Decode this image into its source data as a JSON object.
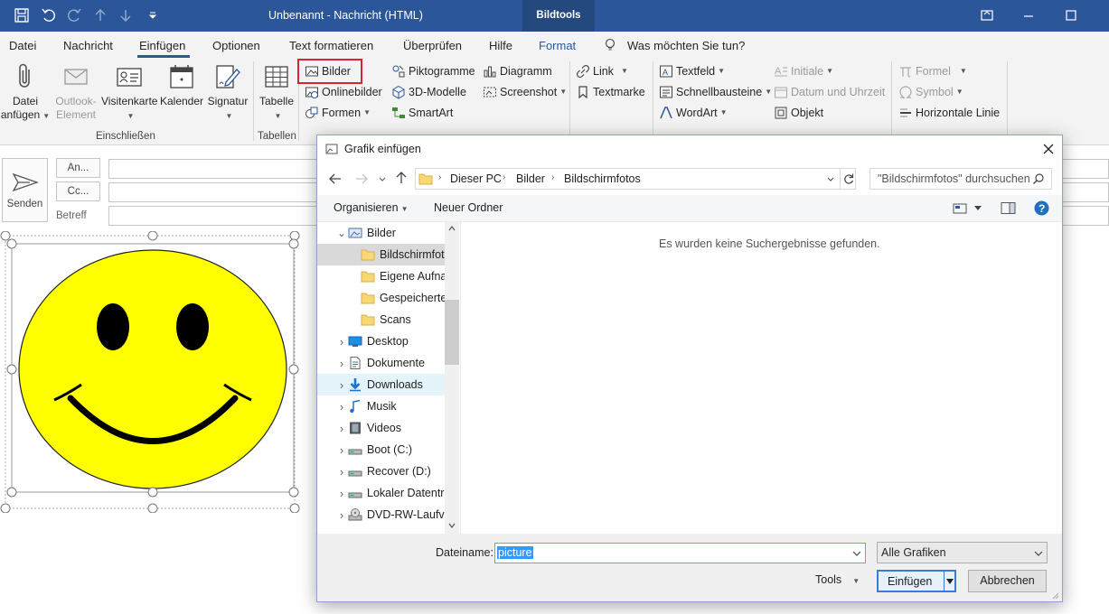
{
  "window": {
    "title": "Unbenannt  -  Nachricht (HTML)",
    "context_tab": "Bildtools"
  },
  "tabs": [
    "Datei",
    "Nachricht",
    "Einfügen",
    "Optionen",
    "Text formatieren",
    "Überprüfen",
    "Hilfe",
    "Format"
  ],
  "active_tab": "Einfügen",
  "tell_me": "Was möchten Sie tun?",
  "ribbon": {
    "include": {
      "attach_file": [
        "Datei",
        "anfügen"
      ],
      "outlook_item": [
        "Outlook-",
        "Element"
      ],
      "business_card": "Visitenkarte",
      "calendar": "Kalender",
      "signature": "Signatur",
      "group_label": "Einschließen"
    },
    "tables": {
      "table": "Tabelle",
      "group_label": "Tabellen"
    },
    "illustrations": {
      "pictures": "Bilder",
      "online_pictures": "Onlinebilder",
      "shapes": "Formen",
      "icons": "Piktogramme",
      "models_3d": "3D-Modelle",
      "smartart": "SmartArt",
      "chart": "Diagramm",
      "screenshot": "Screenshot"
    },
    "links": {
      "link": "Link",
      "bookmark": "Textmarke"
    },
    "text": {
      "textbox": "Textfeld",
      "quick_parts": "Schnellbausteine",
      "wordart": "WordArt",
      "dropcap": "Initiale",
      "date_time": "Datum und Uhrzeit",
      "object": "Objekt"
    },
    "symbols": {
      "equation": "Formel",
      "symbol": "Symbol",
      "horizontal_line": "Horizontale Linie"
    }
  },
  "message": {
    "send": "Senden",
    "to": "An...",
    "cc": "Cc...",
    "subject": "Betreff"
  },
  "dialog": {
    "title": "Grafik einfügen",
    "breadcrumb": [
      "Dieser PC",
      "Bilder",
      "Bildschirmfotos"
    ],
    "search_placeholder": "\"Bildschirmfotos\" durchsuchen",
    "organize": "Organisieren",
    "new_folder": "Neuer Ordner",
    "tree": [
      {
        "label": "Bilder",
        "expanded": true,
        "icon": "pictures-library-icon"
      },
      {
        "label": "Bildschirmfot",
        "child": true,
        "selected": true,
        "icon": "folder-icon"
      },
      {
        "label": "Eigene Aufna",
        "child": true,
        "icon": "folder-icon"
      },
      {
        "label": "Gespeicherte",
        "child": true,
        "icon": "folder-icon"
      },
      {
        "label": "Scans",
        "child": true,
        "icon": "folder-icon"
      },
      {
        "label": "Desktop",
        "icon": "desktop-icon"
      },
      {
        "label": "Dokumente",
        "icon": "documents-icon"
      },
      {
        "label": "Downloads",
        "hover": true,
        "icon": "download-icon"
      },
      {
        "label": "Musik",
        "icon": "music-icon"
      },
      {
        "label": "Videos",
        "icon": "videos-icon"
      },
      {
        "label": "Boot (C:)",
        "icon": "drive-icon"
      },
      {
        "label": "Recover (D:)",
        "icon": "drive-icon"
      },
      {
        "label": "Lokaler Datentr",
        "icon": "drive-icon"
      },
      {
        "label": "DVD-RW-Laufv",
        "icon": "dvd-drive-icon"
      }
    ],
    "empty_message": "Es wurden keine Suchergebnisse gefunden.",
    "filename_label": "Dateiname:",
    "filename_value": "picture",
    "filetype": "Alle Grafiken",
    "tools": "Tools",
    "insert": "Einfügen",
    "cancel": "Abbrechen"
  },
  "colors": {
    "title_bar": "#2b579a",
    "highlight": "#d8262e",
    "smiley": "#ffff00"
  }
}
